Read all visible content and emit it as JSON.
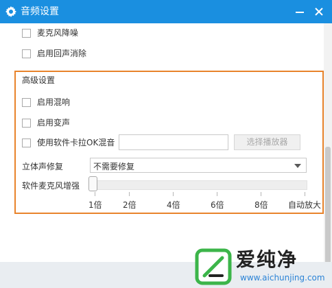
{
  "window": {
    "title": "音频设置"
  },
  "options": {
    "noise_reduction": {
      "label": "麦克风降噪",
      "checked": false
    },
    "echo_cancel": {
      "label": "启用回声消除",
      "checked": false
    }
  },
  "advanced": {
    "title": "高级设置",
    "reverb": {
      "label": "启用混响",
      "checked": false
    },
    "voice_change": {
      "label": "启用变声",
      "checked": false
    },
    "karaoke": {
      "label": "使用软件卡拉OK混音",
      "checked": false,
      "path_value": ""
    },
    "select_player_label": "选择播放器",
    "stereo": {
      "label": "立体声修复",
      "selected": "不需要修复"
    },
    "mic_boost": {
      "label": "软件麦克风增强",
      "value_index": 0,
      "ticks": [
        "1倍",
        "2倍",
        "4倍",
        "6倍",
        "8倍",
        "自动放大"
      ]
    }
  },
  "watermark": {
    "brand": "爱纯净",
    "url": "www.aichunjing.com"
  },
  "colors": {
    "titlebar": "#1a8fe0",
    "group_border": "#e8832a",
    "watermark_green": "#3cb54a"
  }
}
